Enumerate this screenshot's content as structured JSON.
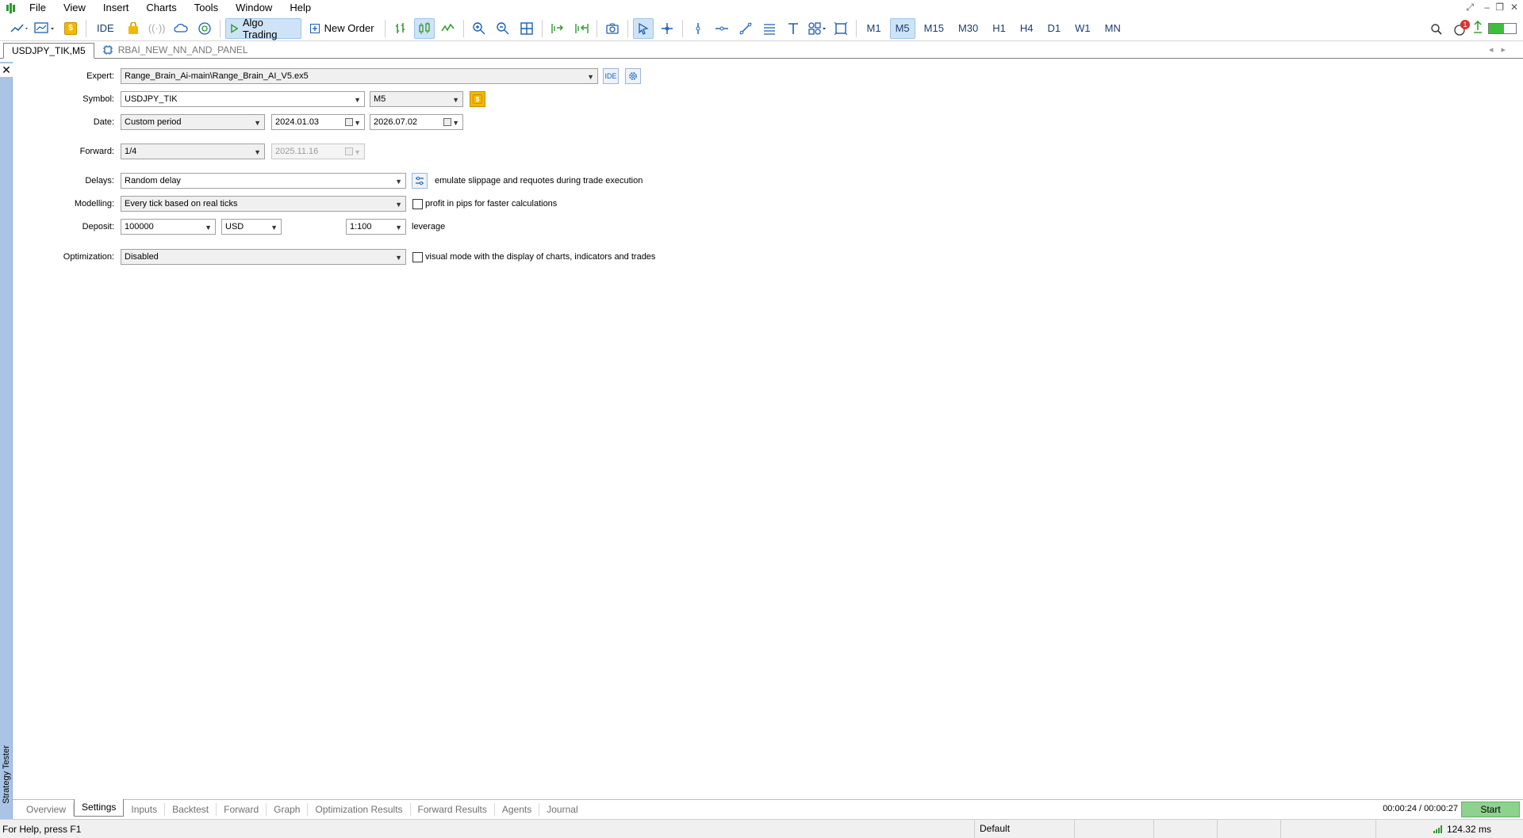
{
  "menu": [
    "File",
    "View",
    "Insert",
    "Charts",
    "Tools",
    "Window",
    "Help"
  ],
  "toolbar": {
    "ide": "IDE",
    "algo_trading": "Algo Trading",
    "new_order": "New Order",
    "timeframes": [
      "M1",
      "M5",
      "M15",
      "M30",
      "H1",
      "H4",
      "D1",
      "W1",
      "MN"
    ],
    "active_timeframe": "M5",
    "notification_count": "1"
  },
  "chart_tabs": [
    "USDJPY_TIK,M5",
    "RBAI_NEW_NN_AND_PANEL"
  ],
  "side_panel_label": "Strategy Tester",
  "settings": {
    "expert_label": "Expert:",
    "expert_value": "Range_Brain_Ai-main\\Range_Brain_AI_V5.ex5",
    "expert_ide": "IDE",
    "symbol_label": "Symbol:",
    "symbol_value": "USDJPY_TIK",
    "timeframe_value": "M5",
    "date_label": "Date:",
    "date_mode": "Custom period",
    "date_from": "2024.01.03",
    "date_to": "2026.07.02",
    "forward_label": "Forward:",
    "forward_value": "1/4",
    "forward_date": "2025.11.16",
    "delays_label": "Delays:",
    "delays_value": "Random delay",
    "delays_note": "emulate slippage and requotes during trade execution",
    "modelling_label": "Modelling:",
    "modelling_value": "Every tick based on real ticks",
    "modelling_note": "profit in pips for faster calculations",
    "deposit_label": "Deposit:",
    "deposit_value": "100000",
    "currency_value": "USD",
    "leverage_value": "1:100",
    "leverage_label": "leverage",
    "optimization_label": "Optimization:",
    "optimization_value": "Disabled",
    "optimization_note": "visual mode with the display of charts, indicators and trades"
  },
  "bottom_tabs": [
    "Overview",
    "Settings",
    "Inputs",
    "Backtest",
    "Forward",
    "Graph",
    "Optimization Results",
    "Forward Results",
    "Agents",
    "Journal"
  ],
  "active_bottom_tab": "Settings",
  "timer": "00:00:24 / 00:00:27",
  "start_label": "Start",
  "status": {
    "help": "For Help, press F1",
    "profile": "Default",
    "ping": "124.32 ms"
  },
  "colors": {
    "accent": "#1a5fb4",
    "start_button": "#8fd18f",
    "side_strip": "#a9c4e4",
    "gold_button": "#f5b800"
  }
}
